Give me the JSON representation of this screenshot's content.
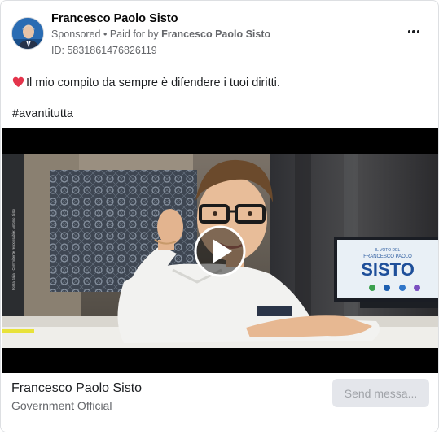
{
  "post": {
    "author": "Francesco Paolo Sisto",
    "sponsored": "Sponsored",
    "separator": "•",
    "paid_for_prefix": "Paid for by",
    "paid_for_name": "Francesco Paolo Sisto",
    "ad_id": "ID: 5831861476826119",
    "body": "Il mio compito da sempre è difendere i tuoi diritti.",
    "hashtag": "#avantitutta"
  },
  "video": {
    "screen_lines": [
      "IL VOTO DEL",
      "FRANCESCO PAOLO",
      "SISTO"
    ],
    "credit": "Forza Italia • Committente responsabile: Antonio Sisto"
  },
  "footer": {
    "page_name": "Francesco Paolo Sisto",
    "category": "Government Official",
    "cta_label": "Send messa..."
  },
  "colors": {
    "accent": "#1877f2",
    "muted": "#65676b",
    "button_bg": "#e4e6eb",
    "heart": "#e4354c"
  }
}
